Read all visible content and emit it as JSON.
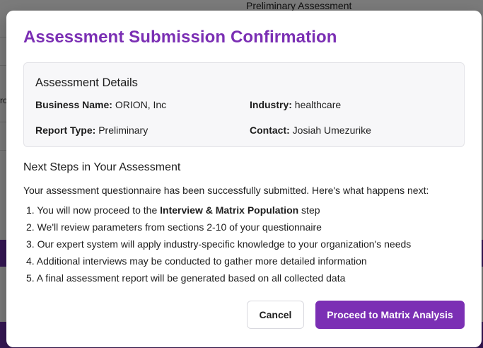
{
  "background": {
    "page_title": "Preliminary Assessment",
    "fragment": "ro"
  },
  "modal": {
    "title": "Assessment Submission Confirmation",
    "details": {
      "heading": "Assessment Details",
      "business_name_label": "Business Name:",
      "business_name_value": "ORION, Inc",
      "industry_label": "Industry:",
      "industry_value": "healthcare",
      "report_type_label": "Report Type:",
      "report_type_value": "Preliminary",
      "contact_label": "Contact:",
      "contact_value": "Josiah Umezurike"
    },
    "next_steps": {
      "heading": "Next Steps in Your Assessment",
      "intro": "Your assessment questionnaire has been successfully submitted. Here's what happens next:",
      "step1_pre": "1. You will now proceed to the ",
      "step1_bold": "Interview & Matrix Population",
      "step1_post": " step",
      "step2": "2. We'll review parameters from sections 2-10 of your questionnaire",
      "step3": "3. Our expert system will apply industry-specific knowledge to your organization's needs",
      "step4": "4. Additional interviews may be conducted to gather more detailed information",
      "step5": "5. A final assessment report will be generated based on all collected data"
    },
    "buttons": {
      "cancel": "Cancel",
      "proceed": "Proceed to Matrix Analysis"
    }
  },
  "colors": {
    "accent": "#7b2fb4",
    "overlay": "rgba(0,0,0,0.5)"
  }
}
